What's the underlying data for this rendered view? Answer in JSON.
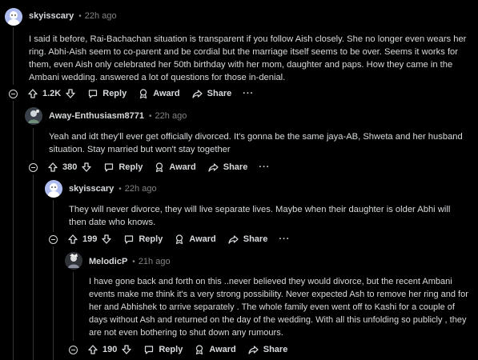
{
  "comments": [
    {
      "user": "skyisscary",
      "time": "22h ago",
      "text": "I said it before, Rai-Bachachan situation is transparent if you follow Aish closely. She no longer even wears her ring. Abhi-Aish seem to co-parent and be cordial but the marriage itself seems to be over. Seems it works for them, even Aish only celebrated her 50th birthday with her mom, daughter and paps. How they came in the Ambani wedding. answered a lot of questions for those in-denial.",
      "votes": "1.2K",
      "reply": "Reply",
      "award": "Award",
      "share": "Share",
      "more": "···"
    },
    {
      "user": "Away-Enthusiasm8771",
      "time": "22h ago",
      "text": "Yeah and idt they'll ever get officially divorced. It's gonna be the same jaya-AB, Shweta and her husband situation. Stay married but won't stay together",
      "votes": "380",
      "reply": "Reply",
      "award": "Award",
      "share": "Share",
      "more": "···"
    },
    {
      "user": "skyisscary",
      "time": "22h ago",
      "text": "They will never divorce, they will live separate lives. Maybe when their daughter is older Abhi will then date who knows.",
      "votes": "199",
      "reply": "Reply",
      "award": "Award",
      "share": "Share",
      "more": "···"
    },
    {
      "user": "MelodicP",
      "time": "21h ago",
      "text": "I have gone back and forth on this ..never believed they would divorce, but the recent Ambani events make me think it's a very strong possibility. Never expected Ash to remove her ring and for her and Abhishek to arrive separately . The whole family even went off to Kashi for a couple of days without Ash and returned on the day of the wedding. With all this unfolding so publicly , they are not even bothering to shut down any rumours.",
      "votes": "190",
      "reply": "Reply",
      "award": "Award",
      "share": "Share"
    }
  ],
  "colors": {
    "background": "#000000",
    "text": "#d7dadc",
    "muted": "#818384",
    "thread_line": "#343536"
  },
  "icons": [
    "upvote-icon",
    "downvote-icon",
    "reply-icon",
    "award-icon",
    "share-icon",
    "collapse-icon"
  ]
}
